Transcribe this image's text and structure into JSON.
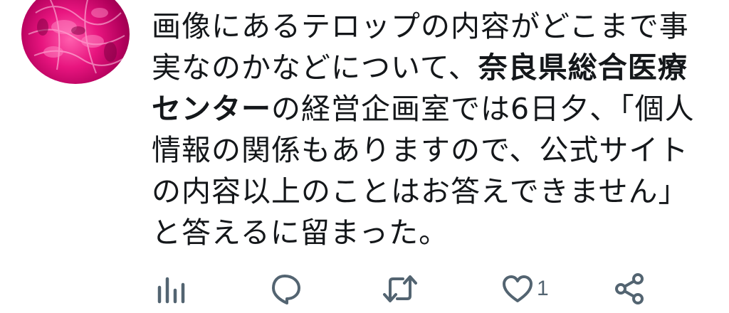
{
  "tweet": {
    "text_part1": "画像にあるテロップの内容がどこまで事実なのかなどについて、",
    "text_bold1": "奈良県総合医療センター",
    "text_part2": "の経営企画室では6日夕、「個人情報の関係もありますので、公式サイトの内容以上のことはお答えできません」と答えるに留まった。"
  },
  "actions": {
    "views_icon": "bar-chart-icon",
    "reply_icon": "reply-bubble-icon",
    "retweet_icon": "retweet-icon",
    "like_icon": "heart-icon",
    "like_count": "1",
    "share_icon": "share-icon"
  },
  "colors": {
    "text": "#14171a",
    "icon": "#536471",
    "avatar_accent": "#e8157f"
  }
}
